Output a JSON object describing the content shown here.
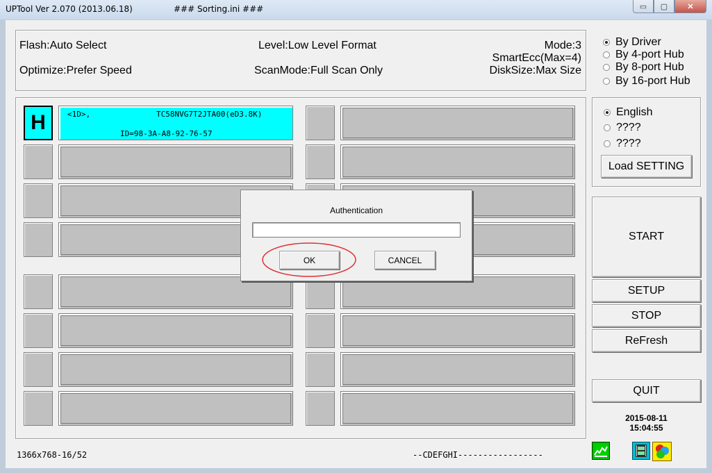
{
  "window": {
    "title": "UPTool Ver 2.070 (2013.06.18)",
    "subtitle": "### Sorting.ini ###",
    "minimize_label": "▭",
    "maximize_label": "▢",
    "close_label": "✕"
  },
  "info": {
    "flash": "Flash:Auto Select",
    "optimize": "Optimize:Prefer Speed",
    "level": "Level:Low Level Format",
    "scanmode": "ScanMode:Full Scan Only",
    "mode": "Mode:3",
    "smartecc": "SmartEcc(Max=4)",
    "disksize": "DiskSize:Max Size"
  },
  "hub_options": [
    {
      "label": "By Driver",
      "selected": true
    },
    {
      "label": "By 4-port Hub",
      "selected": false
    },
    {
      "label": "By 8-port Hub",
      "selected": false
    },
    {
      "label": "By 16-port Hub",
      "selected": false
    }
  ],
  "language_options": [
    {
      "label": "English",
      "selected": true
    },
    {
      "label": "????",
      "selected": false
    },
    {
      "label": "????",
      "selected": false
    }
  ],
  "buttons": {
    "load_setting": "Load SETTING",
    "start": "START",
    "setup": "SETUP",
    "stop": "STOP",
    "refresh": "ReFresh",
    "quit": "QUIT"
  },
  "datetime": {
    "date": "2015-08-11",
    "time": "15:04:55"
  },
  "ports": {
    "active_indicator": "H",
    "active_colors": {
      "fill": "#00ffff",
      "border": "#000000"
    },
    "active_line1_left": "<1D>,",
    "active_line1_right": "TC58NVG7T2JTA00(eD3.8K)",
    "active_line2": "ID=98-3A-A8-92-76-57"
  },
  "status": {
    "resolution": "1366x768-16/52",
    "drives": "--CDEFGHI-----------------"
  },
  "dialog": {
    "title": "Authentication",
    "input_value": "",
    "ok_label": "OK",
    "cancel_label": "CANCEL",
    "highlight_color": "#e03030"
  }
}
